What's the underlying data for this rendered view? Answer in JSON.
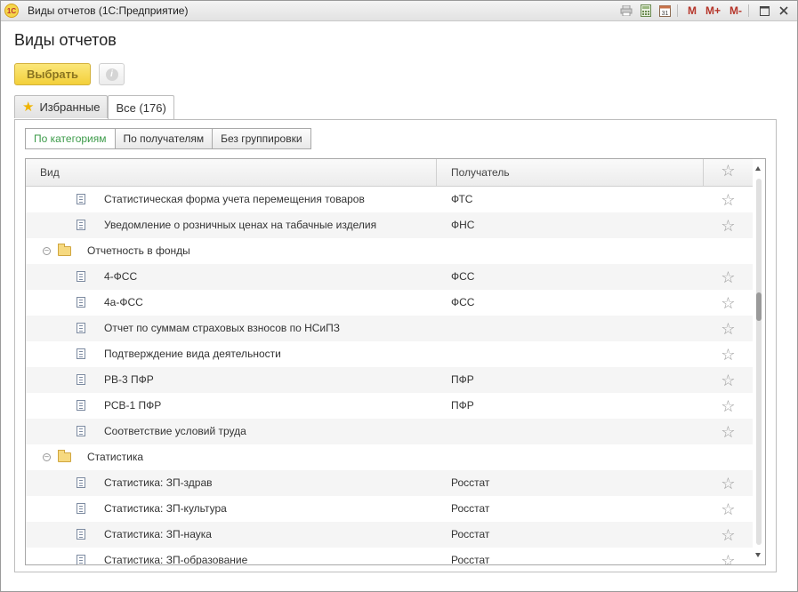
{
  "window": {
    "title": "Виды отчетов  (1С:Предприятие)",
    "logo_text": "1С",
    "m_buttons": [
      "M",
      "M+",
      "M-"
    ]
  },
  "page_title": "Виды отчетов",
  "toolbar": {
    "select_label": "Выбрать",
    "info_symbol": "i"
  },
  "tabs": [
    {
      "label": "Избранные",
      "icon": "star-icon"
    },
    {
      "label": "Все (176)",
      "active": true
    }
  ],
  "grouping": [
    {
      "label": "По категориям",
      "active": true
    },
    {
      "label": "По получателям"
    },
    {
      "label": "Без группировки"
    }
  ],
  "grid": {
    "columns": {
      "vid": "Вид",
      "recipient": "Получатель"
    },
    "rows": [
      {
        "type": "item",
        "name": "Статистическая форма учета перемещения товаров",
        "recipient": "ФТС"
      },
      {
        "type": "item",
        "name": "Уведомление о розничных ценах на табачные изделия",
        "recipient": "ФНС"
      },
      {
        "type": "group",
        "name": "Отчетность в фонды",
        "recipient": ""
      },
      {
        "type": "item",
        "name": "4-ФСС",
        "recipient": "ФСС"
      },
      {
        "type": "item",
        "name": "4а-ФСС",
        "recipient": "ФСС"
      },
      {
        "type": "item",
        "name": "Отчет по суммам страховых взносов по НСиПЗ",
        "recipient": ""
      },
      {
        "type": "item",
        "name": "Подтверждение вида деятельности",
        "recipient": ""
      },
      {
        "type": "item",
        "name": "РВ-3 ПФР",
        "recipient": "ПФР"
      },
      {
        "type": "item",
        "name": "РСВ-1 ПФР",
        "recipient": "ПФР"
      },
      {
        "type": "item",
        "name": "Соответствие условий труда",
        "recipient": ""
      },
      {
        "type": "group",
        "name": "Статистика",
        "recipient": ""
      },
      {
        "type": "item",
        "name": "Статистика: ЗП-здрав",
        "recipient": "Росстат"
      },
      {
        "type": "item",
        "name": "Статистика: ЗП-культура",
        "recipient": "Росстат"
      },
      {
        "type": "item",
        "name": "Статистика: ЗП-наука",
        "recipient": "Росстат"
      },
      {
        "type": "item",
        "name": "Статистика: ЗП-образование",
        "recipient": "Росстат"
      }
    ]
  }
}
